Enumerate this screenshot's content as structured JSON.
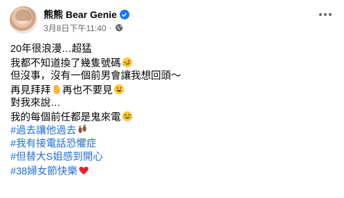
{
  "post": {
    "author": "熊熊 Bear Genie",
    "timestamp": "3月8日下午11:40",
    "separator": "·",
    "lines_1": [
      "20年很浪漫…超猛",
      "我都不知道換了幾隻號碼",
      "但沒事，沒有一個前男會讓我想回頭～",
      "再見拜拜",
      "再也不要見"
    ],
    "lines_2": [
      "對我來說…",
      "我的每個前任都是鬼來電"
    ],
    "hashtags": [
      "#過去讓他過去",
      "#我有接電話恐懼症",
      "#但替大S姐感到開心",
      "#38婦女節快樂"
    ]
  },
  "colors": {
    "verified": "#1877f2",
    "hashtag": "#216fdb",
    "meta": "#65676b",
    "heart": "#e8232f"
  },
  "icons": [
    "verified-badge-icon",
    "globe-icon",
    "more-options-icon",
    "rofl-emoji-icon",
    "waving-hand-emoji-icon",
    "grinning-emoji-icon",
    "footprints-emoji-icon",
    "red-heart-emoji-icon"
  ]
}
